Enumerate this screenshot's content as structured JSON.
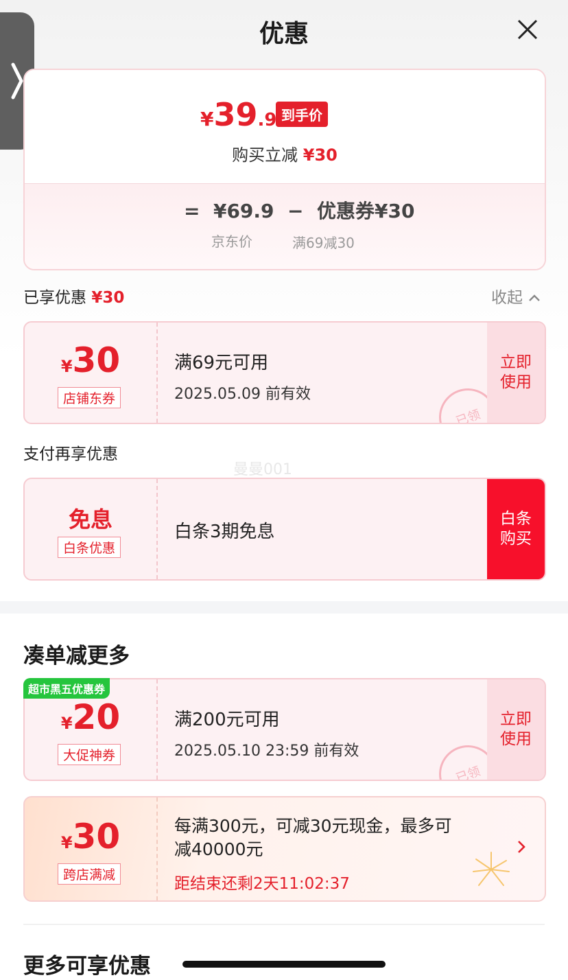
{
  "header": {
    "title": "优惠"
  },
  "summary": {
    "currency": "¥",
    "price_int": "39",
    "price_dec": ".9",
    "final_tag": "到手价",
    "reduce_label": "购买立减",
    "reduce_amount": "¥30",
    "equation": {
      "eq": "=",
      "orig": "¥69.9",
      "minus": "−",
      "coupon_label": "优惠券",
      "coupon_amount": "¥30"
    },
    "orig_caption": "京东价",
    "coupon_caption": "满69减30"
  },
  "enjoyed": {
    "label": "已享优惠",
    "amount": "¥30",
    "collapse": "收起"
  },
  "coupon1": {
    "currency": "¥",
    "amount": "30",
    "badge": "店铺东券",
    "condition": "满69元可用",
    "valid": "2025.05.09 前有效",
    "action": "立即\n使用",
    "stamp": "已领"
  },
  "pay": {
    "label": "支付再享优惠",
    "title": "免息",
    "badge": "白条优惠",
    "desc": "白条3期免息",
    "action": "白条\n购买"
  },
  "watermark": "曼曼001",
  "more_section": {
    "title": "凑单减更多"
  },
  "coupon2": {
    "tag": "超市黑五优惠券",
    "currency": "¥",
    "amount": "20",
    "badge": "大促神券",
    "condition": "满200元可用",
    "valid": "2025.05.10 23:59 前有效",
    "action": "立即\n使用",
    "stamp": "已领"
  },
  "coupon3": {
    "currency": "¥",
    "amount": "30",
    "badge": "跨店满减",
    "desc1": "每满300元，可减30元现金，最多可",
    "desc2": "减40000元",
    "countdown": "距结束还剩2天11:02:37"
  },
  "footer_section": {
    "title": "更多可享优惠"
  },
  "colors": {
    "accent_red": "#e4202b",
    "green_tag": "#25c53d"
  }
}
